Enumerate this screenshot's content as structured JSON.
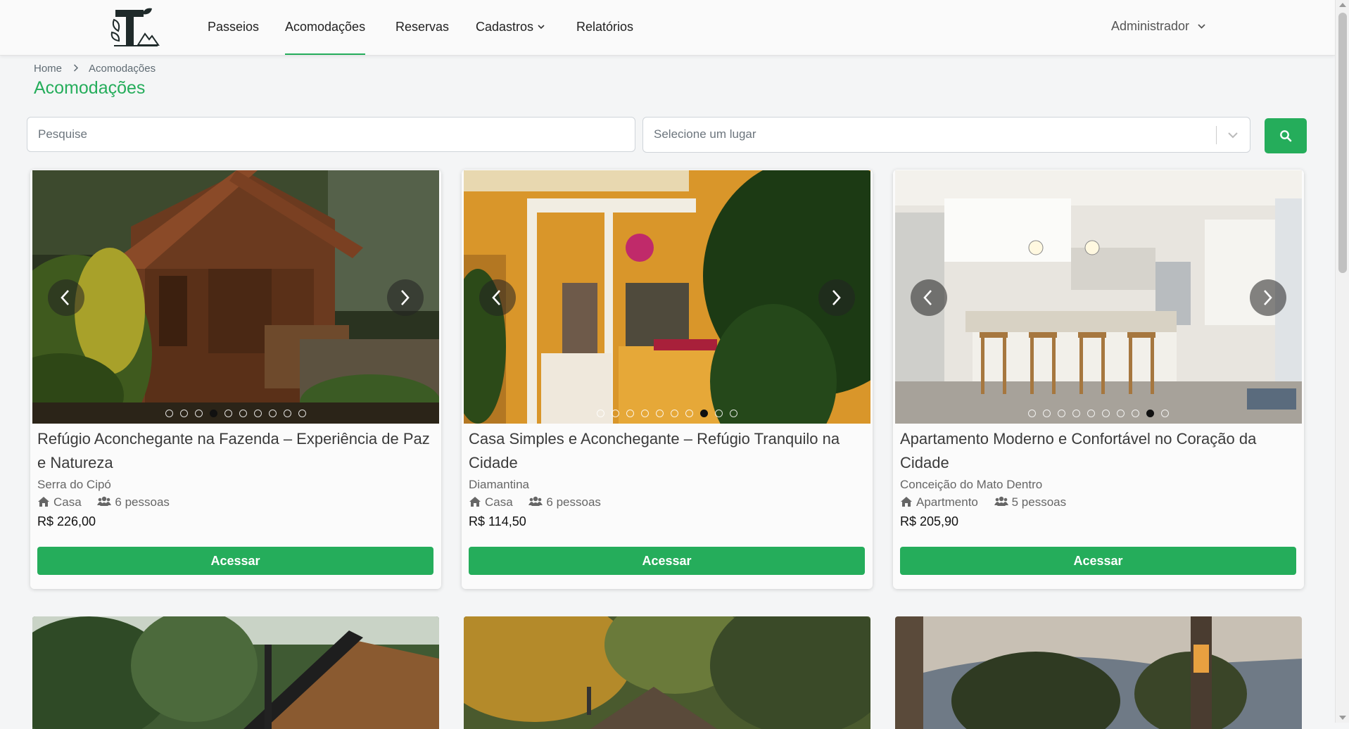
{
  "nav": {
    "logo_icon": "tree-t-logo",
    "links": [
      {
        "label": "Passeios"
      },
      {
        "label": "Acomodações",
        "active": true
      },
      {
        "label": "Reservas"
      },
      {
        "label": "Cadastros",
        "has_dropdown": true
      },
      {
        "label": "Relatórios"
      }
    ],
    "user": "Administrador"
  },
  "breadcrumb": {
    "home": "Home",
    "current": "Acomodações"
  },
  "page_title": "Acomodações",
  "search": {
    "placeholder": "Pesquise",
    "value": ""
  },
  "place_select": {
    "placeholder": "Selecione um lugar"
  },
  "search_button_icon": "search-icon",
  "accent_color": "#25ad5b",
  "cards": [
    {
      "title": "Refúgio Aconchegante na Fazenda – Experiência de Paz e Natureza",
      "location": "Serra do Cipó",
      "type": "Casa",
      "capacity": "6 pessoas",
      "price": "R$ 226,00",
      "button": "Acessar",
      "image_count": 10,
      "active_image": 4
    },
    {
      "title": "Casa Simples e Aconchegante – Refúgio Tranquilo na Cidade",
      "location": "Diamantina",
      "type": "Casa",
      "capacity": "6 pessoas",
      "price": "R$ 114,50",
      "button": "Acessar",
      "image_count": 10,
      "active_image": 8
    },
    {
      "title": "Apartamento Moderno e Confortável no Coração da Cidade",
      "location": "Conceição do Mato Dentro",
      "type": "Apartmento",
      "capacity": "5 pessoas",
      "price": "R$ 205,90",
      "button": "Acessar",
      "image_count": 10,
      "active_image": 9
    }
  ]
}
